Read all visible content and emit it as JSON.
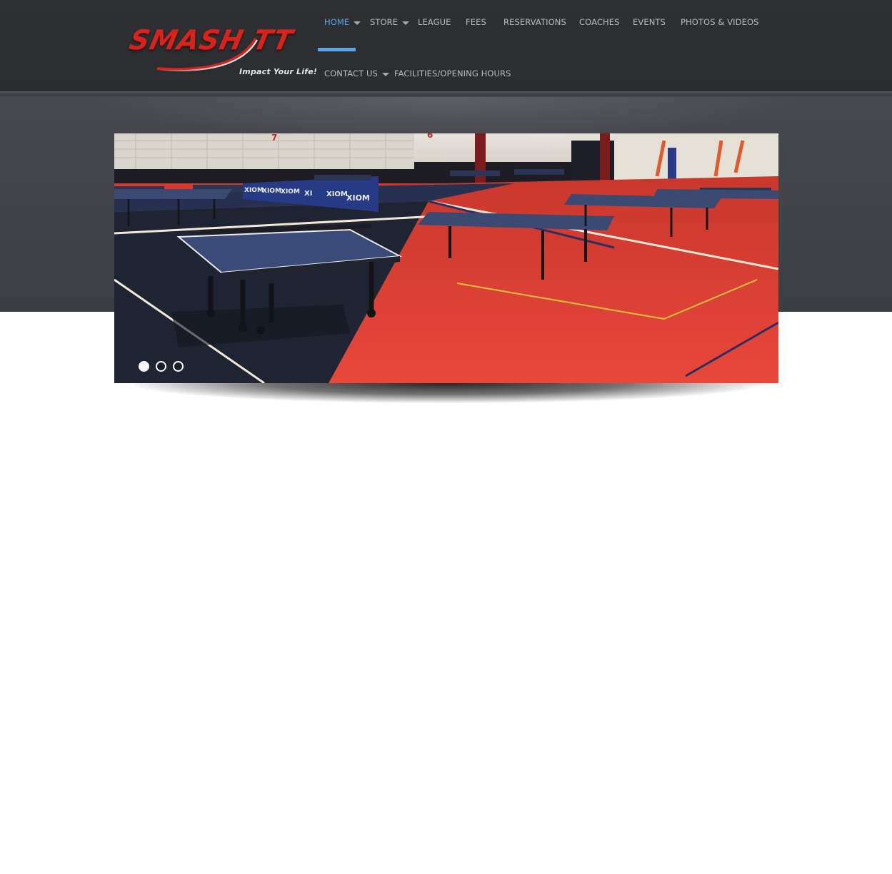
{
  "brand": {
    "name": "SMASH TT",
    "tagline": "Impact Your Life!",
    "colors": {
      "logo_red": "#d8231c",
      "accent": "#5aa4ea",
      "header_bg": "#2c2f32"
    }
  },
  "nav": {
    "items": [
      {
        "label": "HOME",
        "active": true,
        "has_dropdown": true
      },
      {
        "label": "STORE",
        "has_dropdown": true
      },
      {
        "label": "LEAGUE"
      },
      {
        "label": "FEES"
      },
      {
        "label": "RESERVATIONS"
      },
      {
        "label": "COACHES"
      },
      {
        "label": "EVENTS"
      },
      {
        "label": "PHOTOS & VIDEOS"
      },
      {
        "label": "CONTACT US",
        "has_dropdown": true
      },
      {
        "label": "FACILITIES/OPENING HOURS"
      }
    ]
  },
  "slider": {
    "slide_count": 3,
    "active_slide": 1,
    "image": {
      "kind": "photo",
      "subject": "table tennis hall"
    },
    "banner_text": [
      "XIOM",
      "XIOM",
      "XIOM",
      "XIOM",
      "XI",
      "XIOM"
    ],
    "pole_numbers": [
      "7",
      "6"
    ]
  }
}
